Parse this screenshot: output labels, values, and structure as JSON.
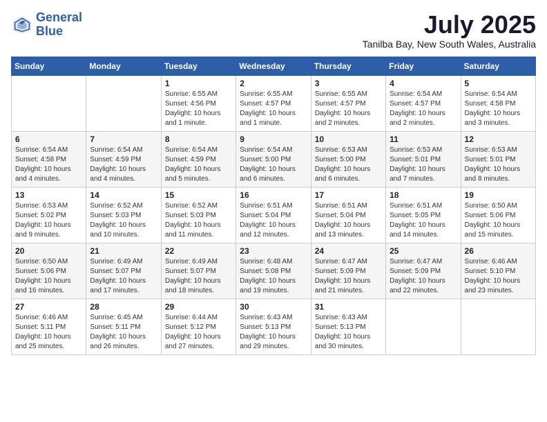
{
  "header": {
    "logo_line1": "General",
    "logo_line2": "Blue",
    "month_year": "July 2025",
    "location": "Tanilba Bay, New South Wales, Australia"
  },
  "weekdays": [
    "Sunday",
    "Monday",
    "Tuesday",
    "Wednesday",
    "Thursday",
    "Friday",
    "Saturday"
  ],
  "weeks": [
    [
      {
        "day": "",
        "info": ""
      },
      {
        "day": "",
        "info": ""
      },
      {
        "day": "1",
        "info": "Sunrise: 6:55 AM\nSunset: 4:56 PM\nDaylight: 10 hours and 1 minute."
      },
      {
        "day": "2",
        "info": "Sunrise: 6:55 AM\nSunset: 4:57 PM\nDaylight: 10 hours and 1 minute."
      },
      {
        "day": "3",
        "info": "Sunrise: 6:55 AM\nSunset: 4:57 PM\nDaylight: 10 hours and 2 minutes."
      },
      {
        "day": "4",
        "info": "Sunrise: 6:54 AM\nSunset: 4:57 PM\nDaylight: 10 hours and 2 minutes."
      },
      {
        "day": "5",
        "info": "Sunrise: 6:54 AM\nSunset: 4:58 PM\nDaylight: 10 hours and 3 minutes."
      }
    ],
    [
      {
        "day": "6",
        "info": "Sunrise: 6:54 AM\nSunset: 4:58 PM\nDaylight: 10 hours and 4 minutes."
      },
      {
        "day": "7",
        "info": "Sunrise: 6:54 AM\nSunset: 4:59 PM\nDaylight: 10 hours and 4 minutes."
      },
      {
        "day": "8",
        "info": "Sunrise: 6:54 AM\nSunset: 4:59 PM\nDaylight: 10 hours and 5 minutes."
      },
      {
        "day": "9",
        "info": "Sunrise: 6:54 AM\nSunset: 5:00 PM\nDaylight: 10 hours and 6 minutes."
      },
      {
        "day": "10",
        "info": "Sunrise: 6:53 AM\nSunset: 5:00 PM\nDaylight: 10 hours and 6 minutes."
      },
      {
        "day": "11",
        "info": "Sunrise: 6:53 AM\nSunset: 5:01 PM\nDaylight: 10 hours and 7 minutes."
      },
      {
        "day": "12",
        "info": "Sunrise: 6:53 AM\nSunset: 5:01 PM\nDaylight: 10 hours and 8 minutes."
      }
    ],
    [
      {
        "day": "13",
        "info": "Sunrise: 6:53 AM\nSunset: 5:02 PM\nDaylight: 10 hours and 9 minutes."
      },
      {
        "day": "14",
        "info": "Sunrise: 6:52 AM\nSunset: 5:03 PM\nDaylight: 10 hours and 10 minutes."
      },
      {
        "day": "15",
        "info": "Sunrise: 6:52 AM\nSunset: 5:03 PM\nDaylight: 10 hours and 11 minutes."
      },
      {
        "day": "16",
        "info": "Sunrise: 6:51 AM\nSunset: 5:04 PM\nDaylight: 10 hours and 12 minutes."
      },
      {
        "day": "17",
        "info": "Sunrise: 6:51 AM\nSunset: 5:04 PM\nDaylight: 10 hours and 13 minutes."
      },
      {
        "day": "18",
        "info": "Sunrise: 6:51 AM\nSunset: 5:05 PM\nDaylight: 10 hours and 14 minutes."
      },
      {
        "day": "19",
        "info": "Sunrise: 6:50 AM\nSunset: 5:06 PM\nDaylight: 10 hours and 15 minutes."
      }
    ],
    [
      {
        "day": "20",
        "info": "Sunrise: 6:50 AM\nSunset: 5:06 PM\nDaylight: 10 hours and 16 minutes."
      },
      {
        "day": "21",
        "info": "Sunrise: 6:49 AM\nSunset: 5:07 PM\nDaylight: 10 hours and 17 minutes."
      },
      {
        "day": "22",
        "info": "Sunrise: 6:49 AM\nSunset: 5:07 PM\nDaylight: 10 hours and 18 minutes."
      },
      {
        "day": "23",
        "info": "Sunrise: 6:48 AM\nSunset: 5:08 PM\nDaylight: 10 hours and 19 minutes."
      },
      {
        "day": "24",
        "info": "Sunrise: 6:47 AM\nSunset: 5:09 PM\nDaylight: 10 hours and 21 minutes."
      },
      {
        "day": "25",
        "info": "Sunrise: 6:47 AM\nSunset: 5:09 PM\nDaylight: 10 hours and 22 minutes."
      },
      {
        "day": "26",
        "info": "Sunrise: 6:46 AM\nSunset: 5:10 PM\nDaylight: 10 hours and 23 minutes."
      }
    ],
    [
      {
        "day": "27",
        "info": "Sunrise: 6:46 AM\nSunset: 5:11 PM\nDaylight: 10 hours and 25 minutes."
      },
      {
        "day": "28",
        "info": "Sunrise: 6:45 AM\nSunset: 5:11 PM\nDaylight: 10 hours and 26 minutes."
      },
      {
        "day": "29",
        "info": "Sunrise: 6:44 AM\nSunset: 5:12 PM\nDaylight: 10 hours and 27 minutes."
      },
      {
        "day": "30",
        "info": "Sunrise: 6:43 AM\nSunset: 5:13 PM\nDaylight: 10 hours and 29 minutes."
      },
      {
        "day": "31",
        "info": "Sunrise: 6:43 AM\nSunset: 5:13 PM\nDaylight: 10 hours and 30 minutes."
      },
      {
        "day": "",
        "info": ""
      },
      {
        "day": "",
        "info": ""
      }
    ]
  ]
}
